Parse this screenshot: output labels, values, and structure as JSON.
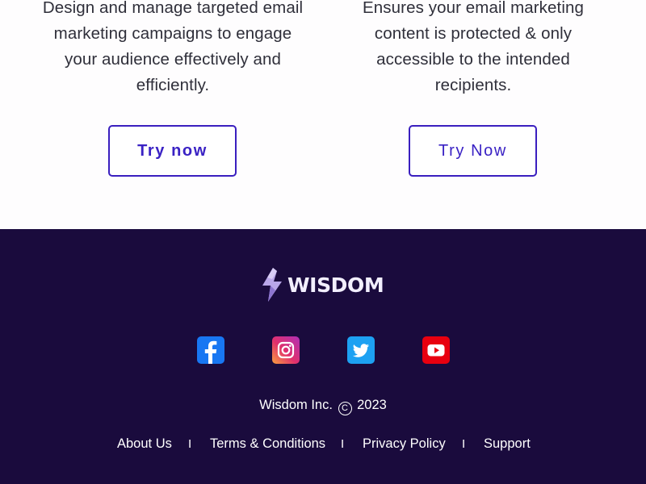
{
  "features": [
    {
      "description_lines": [
        "Design and manage targeted email",
        "marketing campaigns to engage",
        "your audience effectively and",
        "efficiently."
      ],
      "button_label": "Try now"
    },
    {
      "description_lines": [
        "Ensures your email marketing",
        "content is protected & only",
        "accessible to the intended",
        "recipients."
      ],
      "button_label": "Try Now"
    }
  ],
  "footer": {
    "brand": "WISDOM",
    "social": [
      {
        "name": "facebook-icon",
        "color": "#1877f2"
      },
      {
        "name": "instagram-icon",
        "color": "#e1306c"
      },
      {
        "name": "twitter-icon",
        "color": "#1da1f2"
      },
      {
        "name": "youtube-icon",
        "color": "#e8000f"
      }
    ],
    "company": "Wisdom Inc.",
    "copyright_symbol": "C",
    "year": "2023",
    "links": [
      "About Us",
      "Terms & Conditions",
      "Privacy Policy",
      "Support"
    ],
    "separator": "I"
  },
  "colors": {
    "footer_bg": "#1a0b3d",
    "accent": "#3a1fbf"
  }
}
